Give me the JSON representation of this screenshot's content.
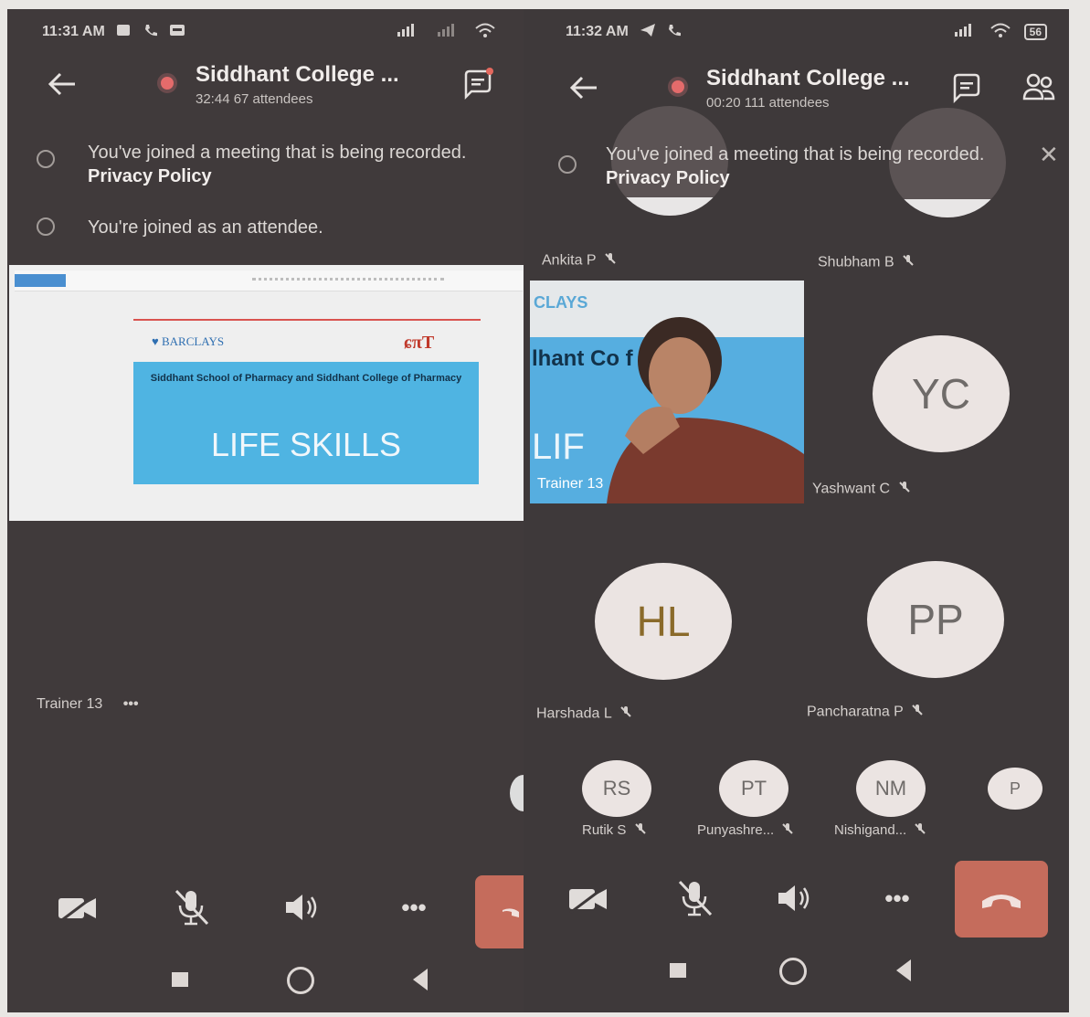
{
  "left": {
    "status_time": "11:31 AM",
    "title": "Siddhant College ...",
    "subtitle": "32:44   67 attendees",
    "notice_recorded": "You've joined a meeting that is being recorded.",
    "privacy_link": "Privacy Policy",
    "notice_attendee": "You're joined as an attendee.",
    "slide": {
      "bank": "BARCLAYS",
      "school_text": "Siddhant School of Pharmacy and Siddhant College of Pharmacy",
      "heading": "LIFE SKILLS"
    },
    "presenter_label": "Trainer 13",
    "presenter_more": "•••"
  },
  "right": {
    "status_time": "11:32 AM",
    "battery": "56",
    "title": "Siddhant College ...",
    "subtitle": "00:20   111 attendees",
    "notice_recorded": "You've joined a meeting that is being recorded.",
    "privacy_link": "Privacy Policy",
    "participants": {
      "ankita": "Ankita P",
      "shubham": "Shubham B",
      "trainer": "Trainer 13",
      "yashwant": "Yashwant C",
      "yashwant_initials": "YC",
      "harshada": "Harshada L",
      "harshada_initials": "HL",
      "pancharatna": "Pancharatna P",
      "pancharatna_initials": "PP"
    },
    "video_overlay": {
      "line1": "CLAYS",
      "line2": "lhant Co    f Phar",
      "line3": "LIF"
    },
    "strip": [
      {
        "initials": "RS",
        "name": "Rutik S"
      },
      {
        "initials": "PT",
        "name": "Punyashre..."
      },
      {
        "initials": "NM",
        "name": "Nishigand..."
      },
      {
        "initials": "P",
        "name": ""
      }
    ],
    "more": "•••"
  }
}
